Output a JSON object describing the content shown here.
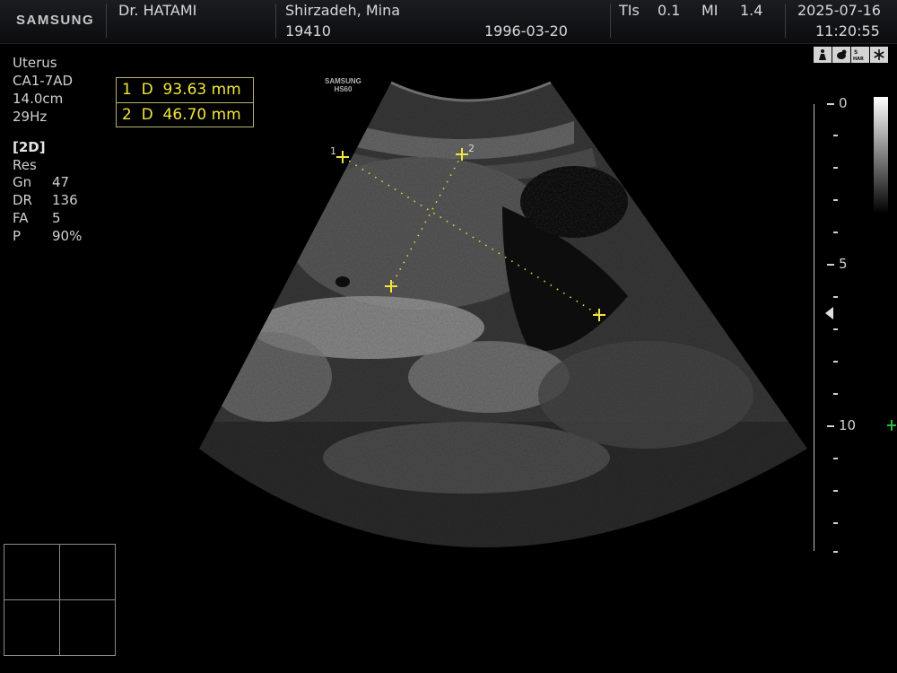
{
  "header": {
    "brand": "SAMSUNG",
    "physician": "Dr. HATAMI",
    "patient_name": "Shirzadeh, Mina",
    "patient_id": "19410",
    "birth_date": "1996-03-20",
    "tis_label": "TIs",
    "tis_value": "0.1",
    "mi_label": "MI",
    "mi_value": "1.4",
    "date": "2025-07-16",
    "time": "11:20:55"
  },
  "probe_info": {
    "preset": "Uterus",
    "probe": "CA1-7AD",
    "depth": "14.0cm",
    "frame_rate": "29Hz"
  },
  "mode": {
    "title": "[2D]",
    "sub": "Res",
    "params": [
      {
        "label": "Gn",
        "value": "47"
      },
      {
        "label": "DR",
        "value": "136"
      },
      {
        "label": "FA",
        "value": "5"
      },
      {
        "label": "P",
        "value": "90%"
      }
    ]
  },
  "measurements": [
    {
      "index": "1",
      "type": "D",
      "value": "93.63 mm"
    },
    {
      "index": "2",
      "type": "D",
      "value": "46.70 mm"
    }
  ],
  "image_labels": {
    "brand": "SAMSUNG",
    "model": "HS60",
    "caliper_1": "1",
    "caliper_2": "2"
  },
  "depth_scale": {
    "labels": [
      "0",
      "5",
      "10"
    ]
  },
  "status_icons": [
    "person-icon",
    "fetus-icon",
    "har-icon",
    "freeze-icon"
  ],
  "colors": {
    "measurement": "#f0e63c",
    "focus_marker": "#2bbf3a"
  }
}
